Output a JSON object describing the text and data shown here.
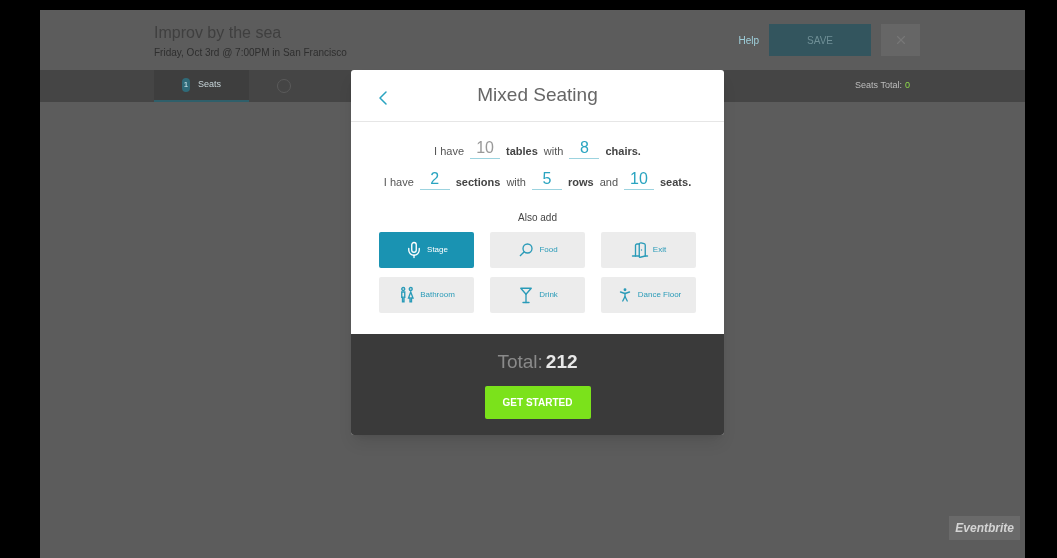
{
  "event": {
    "title": "Improv by the sea",
    "subtitle": "Friday, Oct 3rd @ 7:00PM in San Francisco"
  },
  "header_actions": {
    "help": "Help",
    "save": "SAVE"
  },
  "tabs": [
    {
      "number": "1",
      "label": "Seats",
      "selected": true
    },
    {
      "selected": false
    }
  ],
  "seats_total": {
    "label": "Seats Total:",
    "value": "0"
  },
  "modal": {
    "title": "Mixed Seating",
    "sentences": [
      [
        {
          "kind": "text",
          "text": "I have"
        },
        {
          "kind": "input",
          "placeholder": "10"
        },
        {
          "kind": "bold",
          "text": "tables"
        },
        {
          "kind": "text",
          "text": "with"
        },
        {
          "kind": "input",
          "value": "8"
        },
        {
          "kind": "bold",
          "text": "chairs."
        }
      ],
      [
        {
          "kind": "text",
          "text": "I have"
        },
        {
          "kind": "input",
          "value": "2"
        },
        {
          "kind": "bold",
          "text": "sections"
        },
        {
          "kind": "text",
          "text": "with"
        },
        {
          "kind": "input",
          "value": "5"
        },
        {
          "kind": "bold",
          "text": "rows"
        },
        {
          "kind": "text",
          "text": "and"
        },
        {
          "kind": "input",
          "value": "10"
        },
        {
          "kind": "bold",
          "text": "seats."
        }
      ]
    ],
    "also_add": "Also add",
    "options": [
      {
        "label": "Stage",
        "selected": true
      },
      {
        "label": "Food",
        "selected": false
      },
      {
        "label": "Exit",
        "selected": false
      },
      {
        "label": "Bathroom",
        "selected": false
      },
      {
        "label": "Drink",
        "selected": false
      },
      {
        "label": "Dance Floor",
        "selected": false
      }
    ],
    "total_label": "Total:",
    "total_value": "212",
    "button": "GET STARTED"
  },
  "badge": "Eventbrite"
}
